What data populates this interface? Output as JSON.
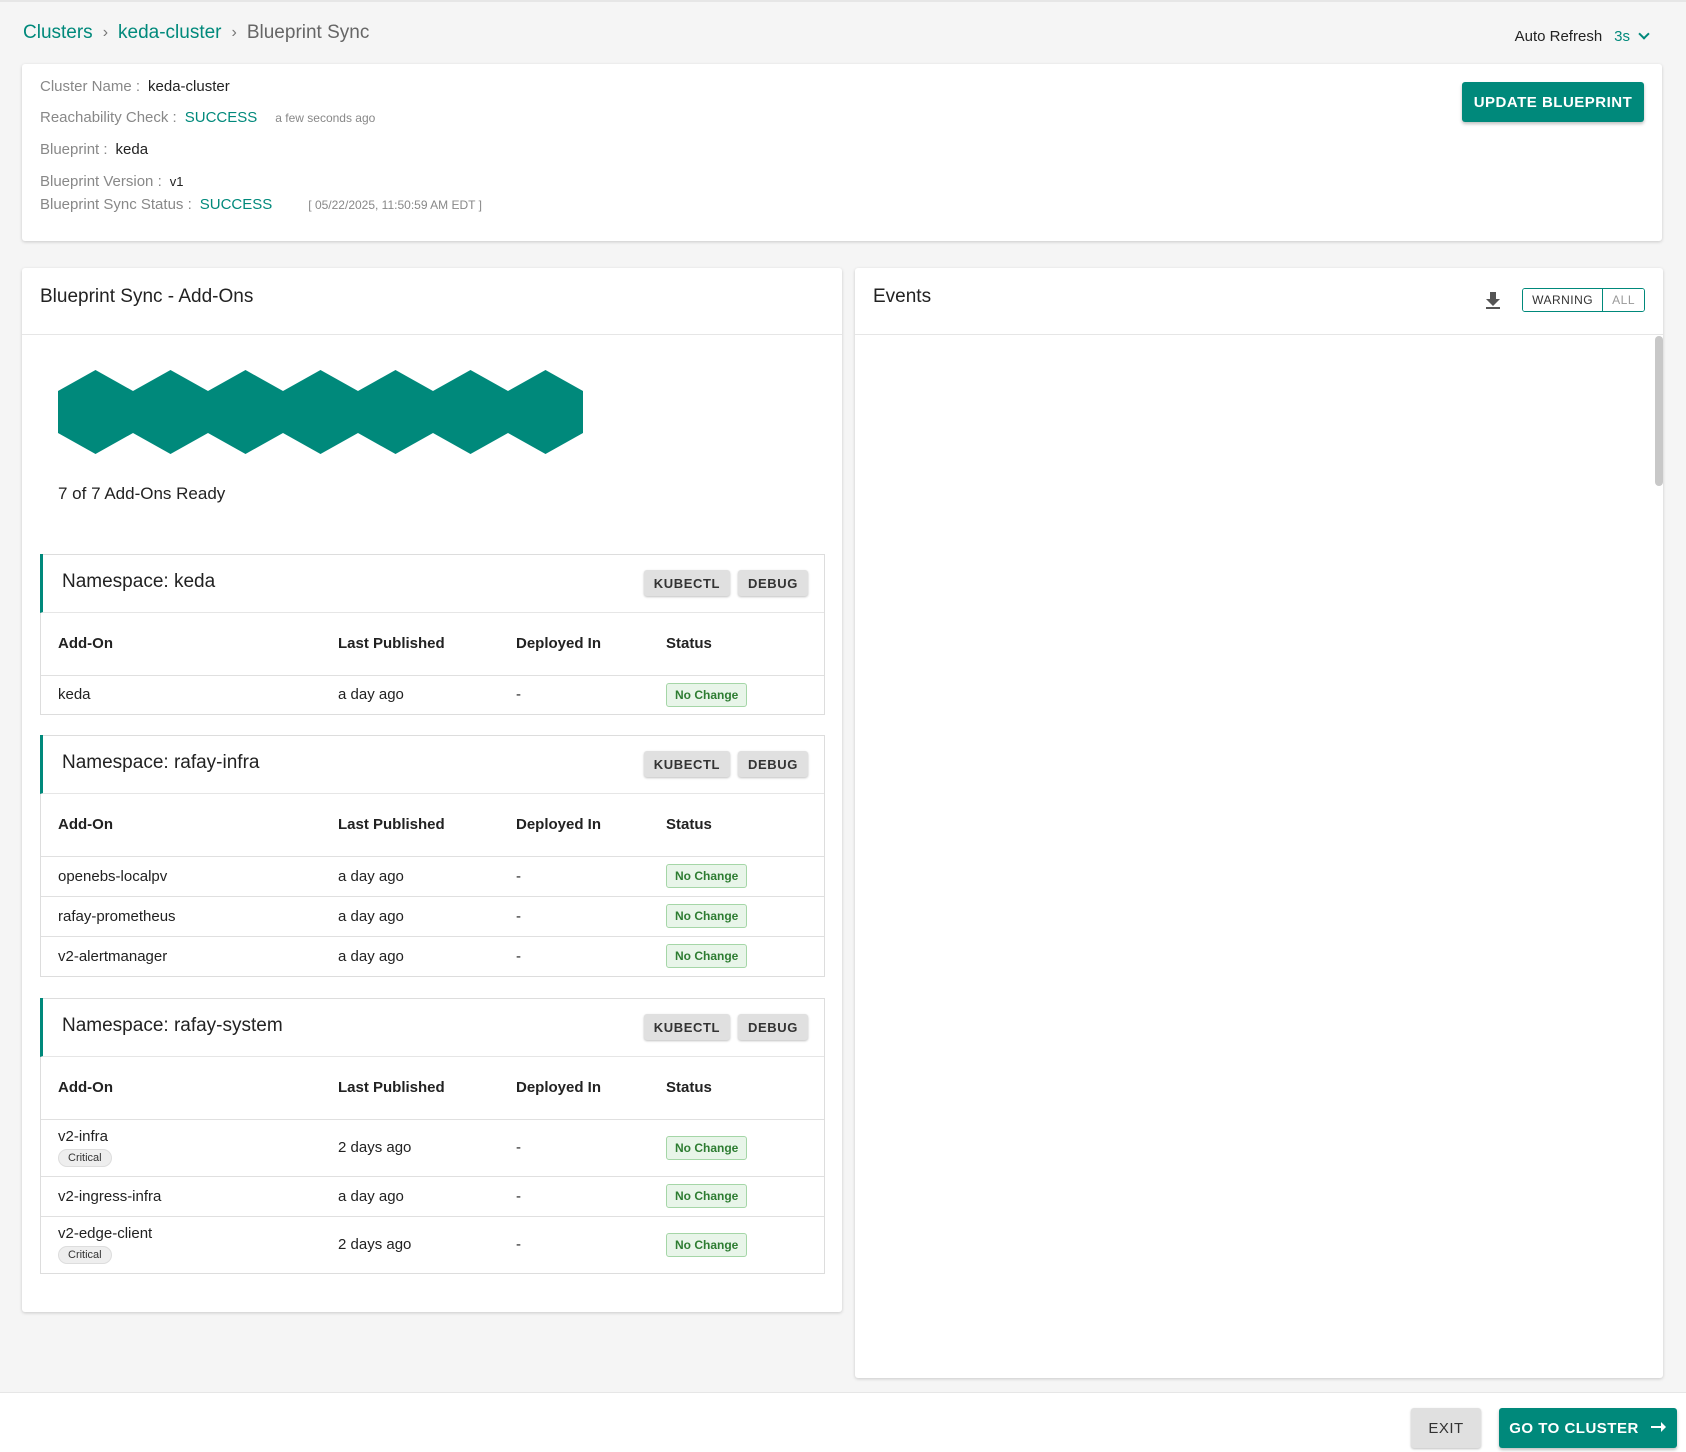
{
  "breadcrumb": {
    "root": "Clusters",
    "cluster": "keda-cluster",
    "current": "Blueprint Sync"
  },
  "auto_refresh": {
    "label": "Auto Refresh",
    "value": "3s"
  },
  "cluster_info": {
    "name_label": "Cluster Name :",
    "name_value": "keda-cluster",
    "reachability_label": "Reachability Check :",
    "reachability_value": "SUCCESS",
    "reachability_time": "a few seconds ago",
    "blueprint_label": "Blueprint :",
    "blueprint_value": "keda",
    "version_label": "Blueprint Version :",
    "version_value": "v1",
    "sync_status_label": "Blueprint Sync Status :",
    "sync_status_value": "SUCCESS",
    "sync_status_time": "[ 05/22/2025, 11:50:59 AM EDT ]",
    "update_button": "UPDATE BLUEPRINT"
  },
  "addons_panel": {
    "title": "Blueprint Sync - Add-Ons",
    "ready_text": "7 of 7 Add-Ons Ready",
    "ready_count": 7,
    "total_count": 7,
    "columns": [
      "Add-On",
      "Last Published",
      "Deployed In",
      "Status"
    ],
    "kubectl_label": "KUBECTL",
    "debug_label": "DEBUG",
    "namespaces": [
      {
        "title": "Namespace: keda",
        "rows": [
          {
            "name": "keda",
            "published": "a day ago",
            "deployed": "-",
            "status": "No Change",
            "critical": ""
          }
        ]
      },
      {
        "title": "Namespace: rafay-infra",
        "rows": [
          {
            "name": "openebs-localpv",
            "published": "a day ago",
            "deployed": "-",
            "status": "No Change",
            "critical": ""
          },
          {
            "name": "rafay-prometheus",
            "published": "a day ago",
            "deployed": "-",
            "status": "No Change",
            "critical": ""
          },
          {
            "name": "v2-alertmanager",
            "published": "a day ago",
            "deployed": "-",
            "status": "No Change",
            "critical": ""
          }
        ]
      },
      {
        "title": "Namespace: rafay-system",
        "rows": [
          {
            "name": "v2-infra",
            "published": "2 days ago",
            "deployed": "-",
            "status": "No Change",
            "critical": "Critical"
          },
          {
            "name": "v2-ingress-infra",
            "published": "a day ago",
            "deployed": "-",
            "status": "No Change",
            "critical": ""
          },
          {
            "name": "v2-edge-client",
            "published": "2 days ago",
            "deployed": "-",
            "status": "No Change",
            "critical": "Critical"
          }
        ]
      }
    ]
  },
  "events_panel": {
    "title": "Events",
    "download_icon": "download-icon",
    "filter_warning": "WARNING",
    "filter_all": "ALL"
  },
  "footer": {
    "exit_label": "EXIT",
    "goto_label": "GO TO CLUSTER",
    "goto_icon": "arrow-right-icon"
  },
  "colors": {
    "accent": "#00897b",
    "success_badge_bg": "#e8f5e9",
    "success_badge_text": "#2e7d32"
  }
}
